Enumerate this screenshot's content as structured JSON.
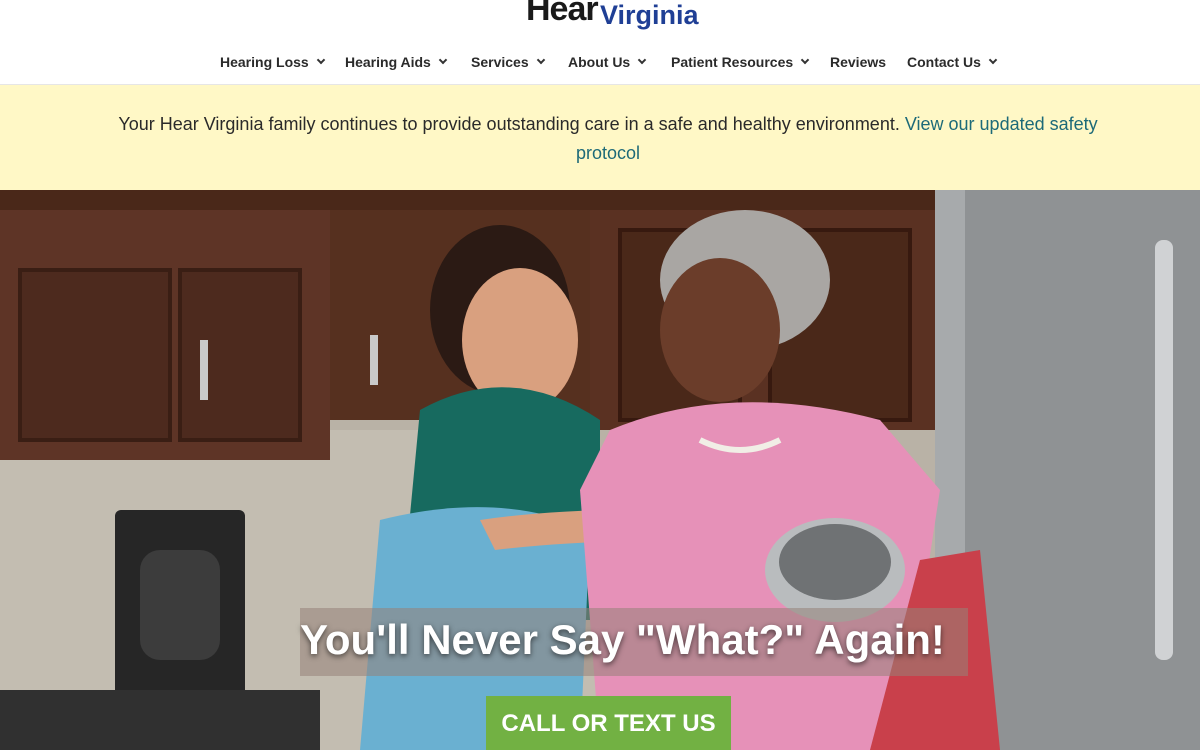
{
  "logo": {
    "word1": "Hear",
    "word2": "Virginia",
    "brand_color": "#1f3f95"
  },
  "nav": {
    "items": [
      {
        "label": "Hearing Loss",
        "has_dropdown": true
      },
      {
        "label": "Hearing Aids",
        "has_dropdown": true
      },
      {
        "label": "Services",
        "has_dropdown": true
      },
      {
        "label": "About Us",
        "has_dropdown": true
      },
      {
        "label": "Patient Resources",
        "has_dropdown": true
      },
      {
        "label": "Reviews",
        "has_dropdown": false
      },
      {
        "label": "Contact Us",
        "has_dropdown": true
      }
    ]
  },
  "notice": {
    "text": "Your Hear Virginia family continues to provide outstanding care in a safe and healthy environment. ",
    "link_text": "View our updated safety protocol",
    "background": "#fff8c6",
    "link_color": "#1d6a78"
  },
  "hero": {
    "headline": "You'll Never Say \"What?\" Again!",
    "cta_label": "CALL OR TEXT US",
    "cta_color": "#72b143"
  }
}
